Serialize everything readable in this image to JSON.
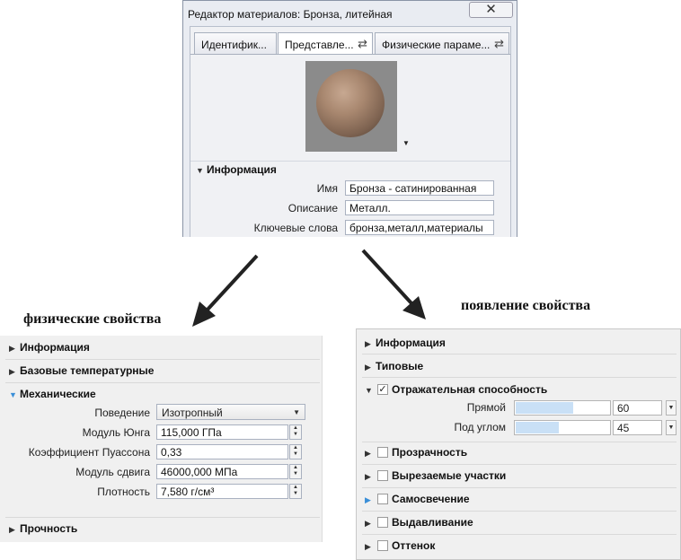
{
  "dialog": {
    "title": "Редактор материалов: Бронза, литейная",
    "close_glyph": "✕",
    "tabs": [
      {
        "label": "Идентифик...",
        "swap": ""
      },
      {
        "label": "Представле...",
        "swap": "⇄"
      },
      {
        "label": "Физические параме...",
        "swap": "⇄"
      }
    ],
    "preview_menu_glyph": "▼",
    "info_section": {
      "title": "Информация",
      "fields": [
        {
          "label": "Имя",
          "value": "Бронза - сатинированная"
        },
        {
          "label": "Описание",
          "value": "Металл."
        },
        {
          "label": "Ключевые слова",
          "value": "бронза,металл,материалы"
        }
      ]
    }
  },
  "captions": {
    "left": "физические свойства",
    "right": "появление свойства"
  },
  "left_panel": {
    "sections": {
      "info": "Информация",
      "base_temp": "Базовые температурные",
      "mechanical": "Механические",
      "strength": "Прочность"
    },
    "behavior": {
      "label": "Поведение",
      "value": "Изотропный"
    },
    "properties": [
      {
        "label": "Модуль Юнга",
        "value": "115,000 ГПа"
      },
      {
        "label": "Коэффициент Пуассона",
        "value": "0,33"
      },
      {
        "label": "Модуль сдвига",
        "value": "46000,000 МПа"
      },
      {
        "label": "Плотность",
        "value": "7,580 г/см³"
      }
    ]
  },
  "right_panel": {
    "sections": {
      "info": "Информация",
      "typical": "Типовые",
      "reflectivity": "Отражательная способность",
      "transparency": "Прозрачность",
      "cutouts": "Вырезаемые участки",
      "self_illum": "Самосвечение",
      "bump": "Выдавливание",
      "tint": "Оттенок"
    },
    "reflectivity": {
      "checked": true,
      "rows": [
        {
          "label": "Прямой",
          "value": "60",
          "fraction": 0.6
        },
        {
          "label": "Под углом",
          "value": "45",
          "fraction": 0.45
        }
      ]
    }
  },
  "colors": {
    "accent_triangle": "#3a8fd8",
    "slider_fill": "#c9e0f6"
  }
}
